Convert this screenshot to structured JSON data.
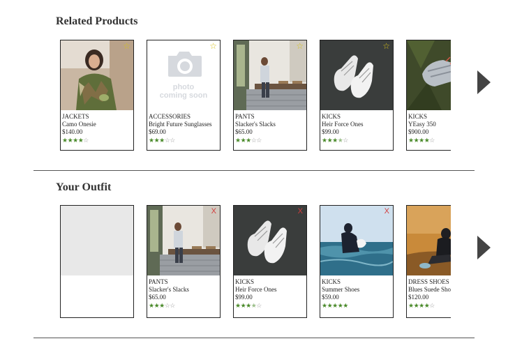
{
  "related": {
    "title": "Related Products",
    "items": [
      {
        "category": "JACKETS",
        "name": "Camo Onesie",
        "price": "$140.00",
        "rating": 4,
        "image": "jacket-photo",
        "action": "☆"
      },
      {
        "category": "ACCESSORIES",
        "name": "Bright Future Sunglasses",
        "price": "$69.00",
        "rating": 3,
        "image": "photo-coming-soon",
        "action": "☆",
        "placeholder_line1": "photo",
        "placeholder_line2": "coming soon"
      },
      {
        "category": "PANTS",
        "name": "Slacker's Slacks",
        "price": "$65.00",
        "rating": 3,
        "image": "cafe-photo",
        "action": "☆"
      },
      {
        "category": "KICKS",
        "name": "Heir Force Ones",
        "price": "$99.00",
        "rating": 3.5,
        "image": "sneakers-photo",
        "action": "☆"
      },
      {
        "category": "KICKS",
        "name": "YEasy 350",
        "price": "$900.00",
        "rating": 4,
        "image": "yeezy-photo",
        "action": "☆"
      }
    ]
  },
  "outfit": {
    "title": "Your Outfit",
    "items": [
      {
        "category": "PANTS",
        "name": "Slacker's Slacks",
        "price": "$65.00",
        "rating": 3,
        "image": "cafe-photo",
        "action": "X"
      },
      {
        "category": "KICKS",
        "name": "Heir Force Ones",
        "price": "$99.00",
        "rating": 3.5,
        "image": "sneakers-photo",
        "action": "X"
      },
      {
        "category": "KICKS",
        "name": "Summer Shoes",
        "price": "$59.00",
        "rating": 5,
        "image": "ocean-photo",
        "action": "X"
      },
      {
        "category": "DRESS SHOES",
        "name": "Blues Suede Shoes",
        "price": "$120.00",
        "rating": 4,
        "image": "suede-photo",
        "action": "X"
      }
    ]
  },
  "colors": {
    "star_filled": "#4a8a2a",
    "favorite_star": "#d8c21a",
    "remove_x": "#d23c3c",
    "arrow": "#444444"
  },
  "icons": {
    "next_arrow": "chevron-right-icon",
    "favorite": "star-icon",
    "remove": "close-icon"
  }
}
